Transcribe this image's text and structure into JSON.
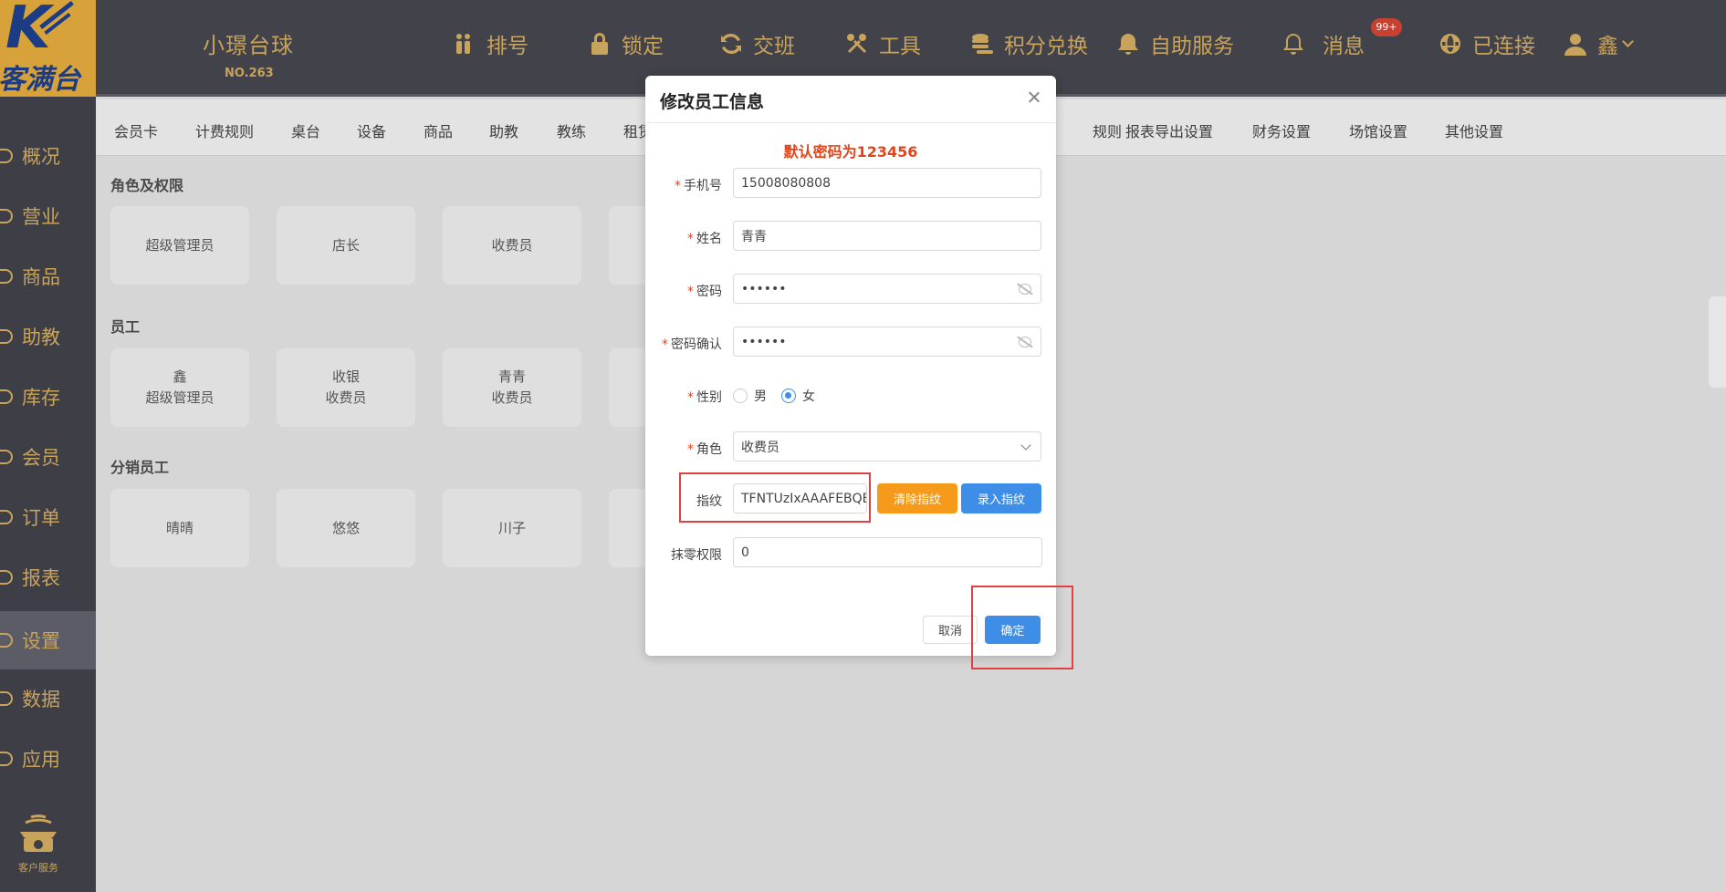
{
  "store": {
    "name": "小璟台球",
    "number": "NO.263"
  },
  "logo": {
    "text": "客满台"
  },
  "topnav": {
    "items": [
      {
        "label": "排号",
        "icon": "queue-icon"
      },
      {
        "label": "锁定",
        "icon": "lock-icon"
      },
      {
        "label": "交班",
        "icon": "shift-change-icon"
      },
      {
        "label": "工具",
        "icon": "tools-icon"
      },
      {
        "label": "积分兑换",
        "icon": "coins-icon"
      },
      {
        "label": "自助服务",
        "icon": "bell-service-icon"
      },
      {
        "label": "消息",
        "icon": "bell-icon"
      },
      {
        "label": "已连接",
        "icon": "globe-icon"
      },
      {
        "label": "鑫",
        "icon": "user-icon"
      }
    ],
    "message_badge": "99+"
  },
  "sidebar": {
    "items": [
      "概况",
      "营业",
      "商品",
      "助教",
      "库存",
      "会员",
      "订单",
      "报表",
      "设置",
      "数据",
      "应用"
    ],
    "active": "设置",
    "support_label": "客户服务"
  },
  "subnav": {
    "items": [
      "会员卡",
      "计费规则",
      "桌台",
      "设备",
      "商品",
      "助教",
      "教练",
      "租赁",
      "积分规则",
      "报表导出设置",
      "财务设置",
      "场馆设置",
      "其他设置"
    ]
  },
  "sections": {
    "roles_title": "角色及权限",
    "roles": [
      "超级管理员",
      "店长",
      "收费员"
    ],
    "staff_title": "员工",
    "staff": [
      {
        "name": "鑫",
        "role": "超级管理员"
      },
      {
        "name": "收银",
        "role": "收费员"
      },
      {
        "name": "青青",
        "role": "收费员"
      }
    ],
    "dist_title": "分销员工",
    "dist": [
      "晴晴",
      "悠悠",
      "川子"
    ]
  },
  "dialog": {
    "title": "修改员工信息",
    "default_password_note": "默认密码为123456",
    "fields": {
      "phone": {
        "label": "手机号",
        "value": "15008080808"
      },
      "name": {
        "label": "姓名",
        "value": "青青"
      },
      "password": {
        "label": "密码",
        "value": "••••••"
      },
      "password_confirm": {
        "label": "密码确认",
        "value": "••••••"
      },
      "gender": {
        "label": "性别",
        "male": "男",
        "female": "女",
        "selected": "女"
      },
      "role": {
        "label": "角色",
        "value": "收费员"
      },
      "fingerprint": {
        "label": "指纹",
        "value": "TFNTUzIxAAAFEBQE"
      },
      "round_limit": {
        "label": "抹零权限",
        "value": "0"
      }
    },
    "buttons": {
      "clear_fingerprint": "清除指纹",
      "enroll_fingerprint": "录入指纹",
      "cancel": "取消",
      "confirm": "确定"
    }
  },
  "colors": {
    "accent_gold": "#c8a35c",
    "primary_blue": "#3e8ee8",
    "orange": "#f59a1a",
    "required_red": "#e0461e"
  }
}
